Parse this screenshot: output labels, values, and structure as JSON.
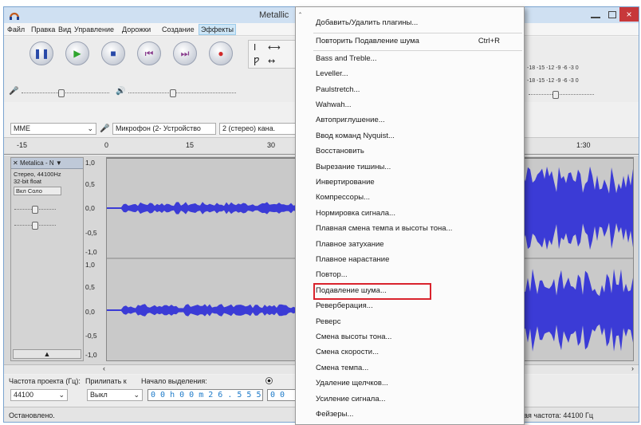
{
  "window": {
    "title": "Metallic",
    "close_glyph": "×"
  },
  "menubar": [
    "Файл",
    "Правка",
    "Вид",
    "Управление",
    "Дорожки",
    "Создание",
    "Эффекты"
  ],
  "toolbar": {
    "buttons": [
      "pause-icon",
      "play-icon",
      "stop-icon",
      "skip-start-icon",
      "skip-end-icon",
      "record-icon"
    ],
    "tools": [
      "I",
      "⟷",
      "Ƿ",
      "↔"
    ],
    "meter_left": "-18 -15 -12 -9 -6 -3 0",
    "meter_right": "-18 -15 -12 -9 -6 -3 0"
  },
  "devices": {
    "host": "MME",
    "input": "Микрофон (2- Устройство",
    "channels": "2 (стерео) кана."
  },
  "ruler": {
    "labels": [
      "-15",
      "0",
      "15",
      "30",
      "1:30"
    ]
  },
  "track": {
    "name": "Metalica - N",
    "info": [
      "Стерео, 44100Hz",
      "32-bit float"
    ],
    "mute_solo": "Вкл   Соло",
    "scale": [
      "1,0",
      "0,5",
      "0,0",
      "-0,5",
      "-1,0",
      "1,0",
      "0,5",
      "0,0",
      "-0,5",
      "-1,0"
    ]
  },
  "bottom": {
    "rate_label": "Частота проекта (Гц):",
    "rate_value": "44100",
    "snap_label": "Прилипать к",
    "snap_value": "Выкл",
    "sel_start_label": "Начало выделения:",
    "sel_start_value": "0 0 h 0 0 m 2 6 . 5 5 5 s",
    "end_value": "0 0"
  },
  "status": {
    "left": "Остановлено.",
    "right": "ая частота: 44100 Гц"
  },
  "menu": {
    "items": [
      {
        "label": "Добавить/Удалить плагины..."
      },
      {
        "label": "Повторить Подавление шума",
        "shortcut": "Ctrl+R"
      },
      {
        "label": "Bass and Treble..."
      },
      {
        "label": "Leveller..."
      },
      {
        "label": "Paulstretch..."
      },
      {
        "label": "Wahwah..."
      },
      {
        "label": "Автоприглушение..."
      },
      {
        "label": "Ввод команд Nyquist..."
      },
      {
        "label": "Восстановить"
      },
      {
        "label": "Вырезание тишины..."
      },
      {
        "label": "Инвертирование"
      },
      {
        "label": "Компрессоры..."
      },
      {
        "label": "Нормировка сигнала..."
      },
      {
        "label": "Плавная смена темпа и высоты тона..."
      },
      {
        "label": "Плавное затухание"
      },
      {
        "label": "Плавное нарастание"
      },
      {
        "label": "Повтор..."
      },
      {
        "label": "Подавление шума...",
        "highlighted": true
      },
      {
        "label": "Реверберация..."
      },
      {
        "label": "Реверс"
      },
      {
        "label": "Смена высоты тона..."
      },
      {
        "label": "Смена скорости..."
      },
      {
        "label": "Смена темпа..."
      },
      {
        "label": "Удаление щелчков..."
      },
      {
        "label": "Усиление сигнала..."
      },
      {
        "label": "Фейзеры..."
      }
    ]
  },
  "colors": {
    "waveform": "#3b3bd6",
    "highlight": "#d9232d",
    "accent": "#1e7bc9"
  }
}
